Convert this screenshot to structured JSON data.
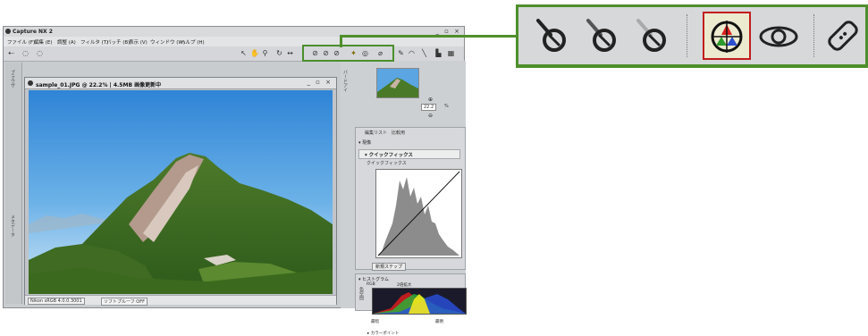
{
  "app": {
    "title": "Capture NX 2",
    "window_controls": "_ ▫ ×"
  },
  "menubar": {
    "items": [
      "ファイル (F)",
      "編集 (E)",
      "調整 (A)",
      "フィルタ (T)",
      "バッチ (B)",
      "表示 (V)",
      "ウィンドウ (W)",
      "ヘルプ (H)"
    ]
  },
  "document": {
    "title": "sample_01.JPG @ 22.2% | 4.5MB 画像更新中",
    "window_controls": "_ ▫ ×",
    "status_color_space": "Nikon sRGB 4.0.0.3001",
    "status_softproof": "ソフトプルーフ OFF"
  },
  "left_dock": {
    "label_top": "ブラウザ",
    "label_mid": "メタデータ"
  },
  "right_panel": {
    "birdseye_label": "バードアイ",
    "zoom_value": "22.2",
    "zoom_unit": "%",
    "edit_tabs": [
      "編集リスト",
      "比較用"
    ],
    "section_label": "▾ 現像",
    "quickfix_title": "▾ クイックフィックス",
    "quickfix_sub": "クイックフィックス",
    "new_step_button": "新規ステップ",
    "histogram_section": "▾ ヒストグラム",
    "histogram_channel": "RGB",
    "histogram_option": "2倍拡大",
    "histogram_low_label": "最暗",
    "histogram_high_label": "最明",
    "histogram_side_label": "色空間",
    "lower_section": "▸ カラーポイント"
  },
  "callout": {
    "tools": [
      "black-point-picker-icon",
      "neutral-point-picker-icon",
      "white-point-picker-icon",
      "color-control-point-icon",
      "red-eye-icon",
      "auto-retouch-brush-icon"
    ],
    "selected_tool": "color-control-point-icon",
    "frame_color": "#4f8f2c",
    "highlight_color": "#c21d1d"
  }
}
